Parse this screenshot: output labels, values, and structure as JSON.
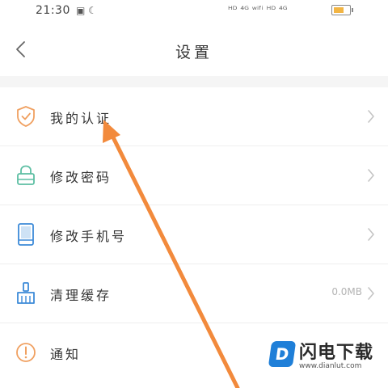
{
  "status_bar": {
    "time": "21:30",
    "left_icons": "▣ ☾",
    "right_icons": "ᴴᴰ ⁴ᴳ ʷⁱᶠⁱ ᴴᴰ ⁴ᴳ",
    "battery_level": 0.65
  },
  "header": {
    "title": "设置"
  },
  "menu": {
    "items": [
      {
        "label": "我的认证",
        "icon": "shield-check-icon",
        "value": ""
      },
      {
        "label": "修改密码",
        "icon": "lock-icon",
        "value": ""
      },
      {
        "label": "修改手机号",
        "icon": "phone-icon",
        "value": ""
      },
      {
        "label": "清理缓存",
        "icon": "broom-icon",
        "value": "0.0MB"
      },
      {
        "label": "通知",
        "icon": "alert-circle-icon",
        "value": ""
      }
    ]
  },
  "watermark": {
    "logo_letter": "D",
    "brand": "闪电下载",
    "url": "www.dianlut.com"
  },
  "colors": {
    "accent_orange": "#f0a060",
    "icon_green": "#5dbfa3",
    "icon_blue": "#3c8ad8",
    "arrow": "#f28a3c",
    "separator": "#eeeeee",
    "section_gap": "#f5f5f5"
  }
}
